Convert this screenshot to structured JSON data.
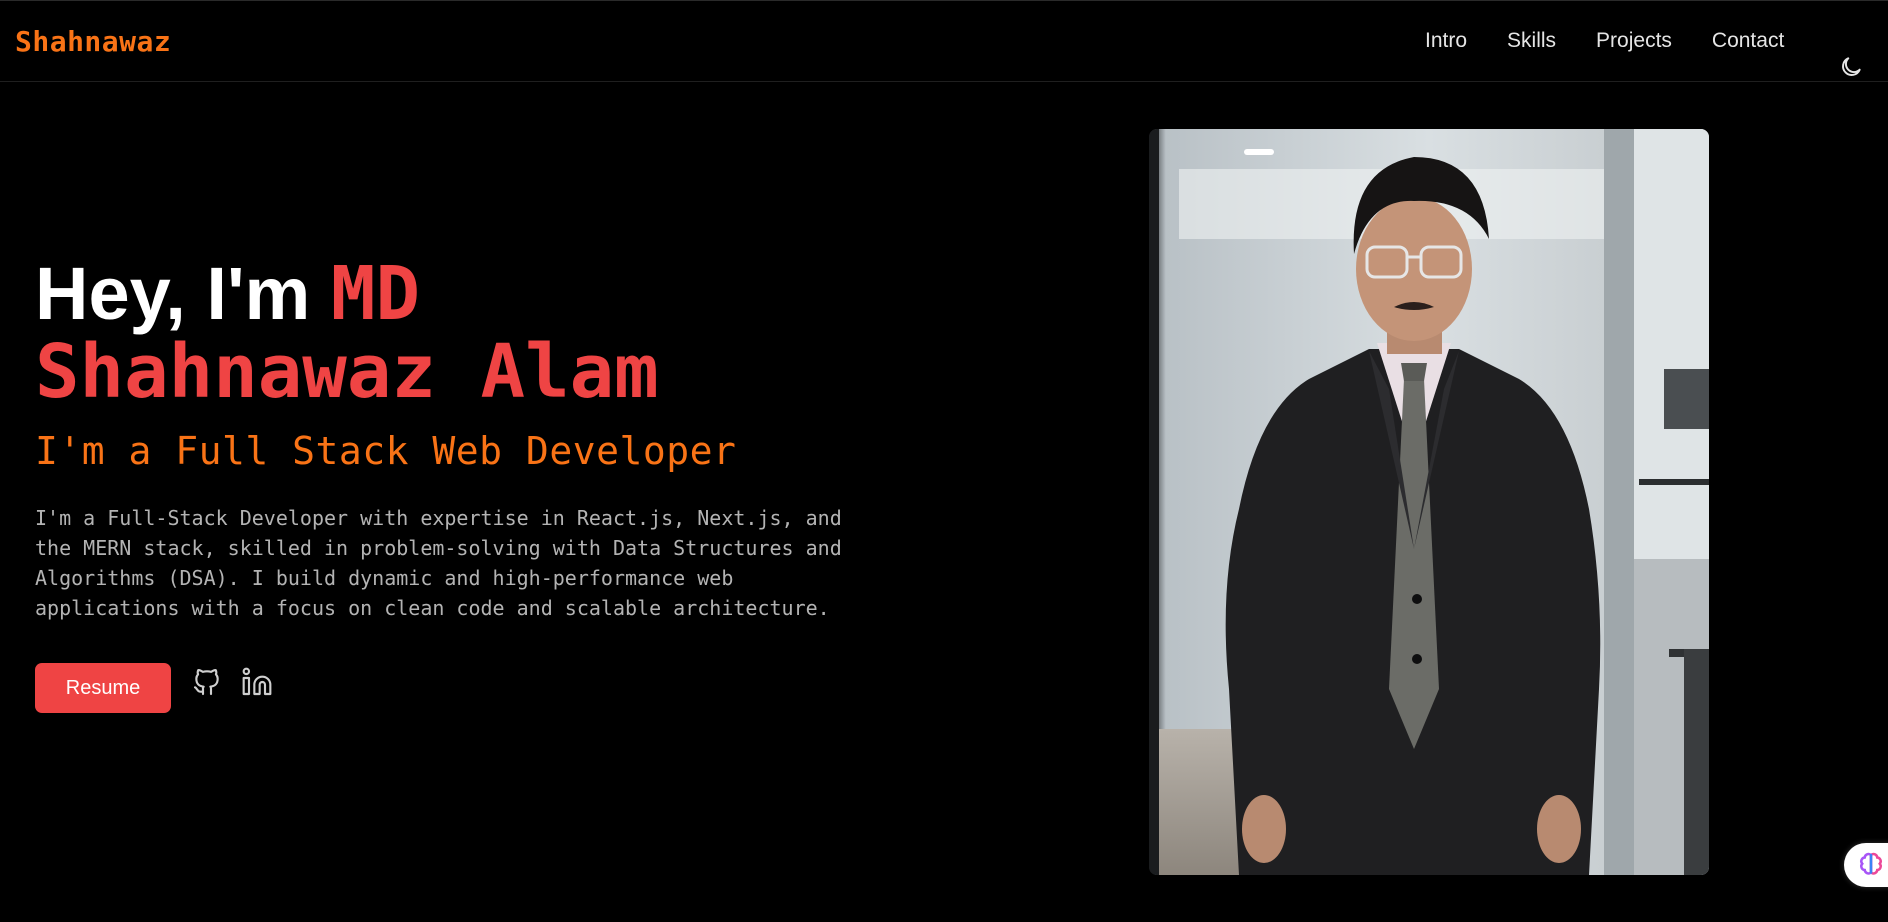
{
  "header": {
    "brand": "Shahnawaz",
    "nav": [
      "Intro",
      "Skills",
      "Projects",
      "Contact"
    ],
    "theme_toggle_icon": "moon-icon"
  },
  "hero": {
    "greeting": "Hey, I'm",
    "name_first": "MD",
    "name_rest": "Shahnawaz Alam",
    "role": "I'm a Full Stack Web Developer",
    "bio": "I'm a Full-Stack Developer with expertise in React.js, Next.js, and the MERN stack, skilled in problem-solving with Data Structures and Algorithms (DSA). I build dynamic and high-performance web applications with a focus on clean code and scalable architecture.",
    "resume_label": "Resume",
    "social_icons": [
      "github-icon",
      "linkedin-icon"
    ]
  },
  "portrait": {
    "icon": "profile-photo"
  },
  "widget": {
    "icon": "brain-icon"
  },
  "colors": {
    "background": "#000000",
    "brand": "#f97316",
    "accent": "#ef4444",
    "body_text": "#b3b3b3",
    "nav_text": "#e5e5e5"
  }
}
